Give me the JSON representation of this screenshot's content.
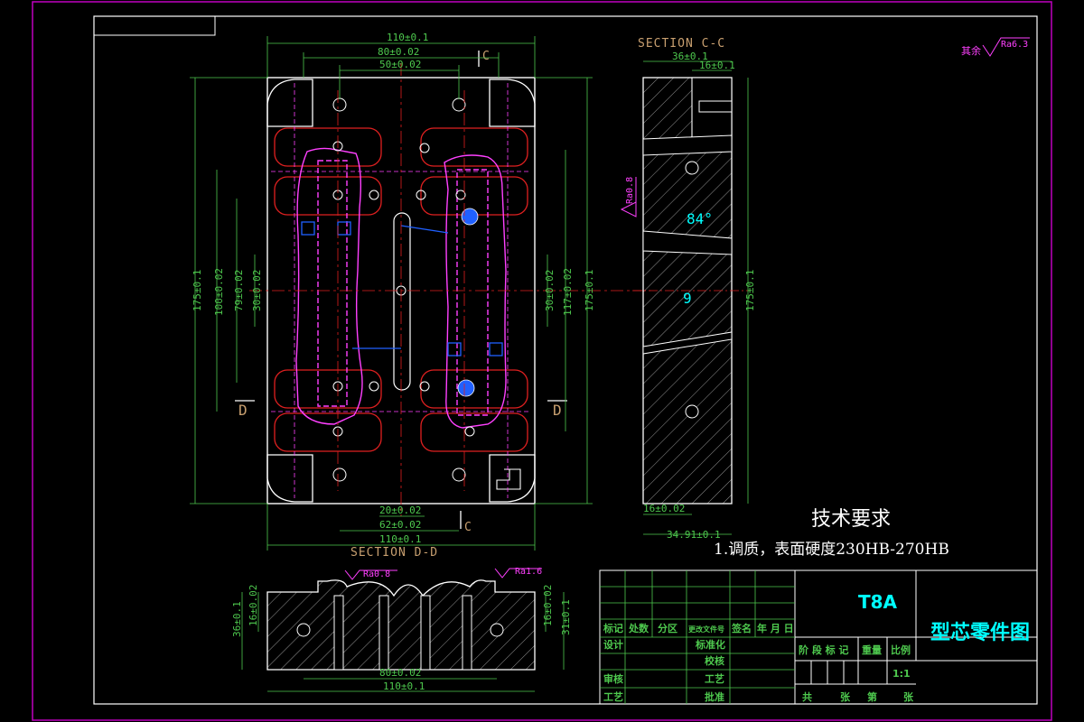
{
  "drawing": {
    "section_cc_title": "SECTION C-C",
    "section_dd_title": "SECTION D-D",
    "section_marker_c": "C",
    "section_marker_d": "D",
    "roughness_note": "其余",
    "roughness_default": "Ra6.3",
    "roughness_08": "Ra0.8",
    "roughness_16": "Ra1.6",
    "tech_title": "技术要求",
    "tech_item_1": "1.调质，表面硬度230HB-270HB"
  },
  "dimensions": {
    "top_110": "110±0.1",
    "top_80": "80±0.02",
    "top_50": "50±0.02",
    "bottom_20": "20±0.02",
    "bottom_62": "62±0.02",
    "bottom_110": "110±0.1",
    "left_175": "175±0.1",
    "left_100": "100±0.02",
    "left_79": "79±0.02",
    "left_30": "30±0.02",
    "right_30": "30±0.02",
    "right_117": "117±0.02",
    "right_175": "175±0.1",
    "cc_36": "36±0.1",
    "cc_16": "16±0.1",
    "cc_175": "175±0.1",
    "cc_bottom_16": "16±0.02",
    "cc_bottom_34": "34.91±0.1",
    "cc_angle": "84°",
    "cc_9": "9",
    "dd_36": "36±0.1",
    "dd_16_left": "16±0.02",
    "dd_16_right": "16±0.02",
    "dd_31": "31±0.1",
    "dd_80": "80±0.02",
    "dd_110": "110±0.1"
  },
  "title_block": {
    "material": "T8A",
    "drawing_name": "型芯零件图",
    "label_mark": "标记",
    "label_count": "处数",
    "label_zone": "分区",
    "label_doc": "更改文件号",
    "label_sign": "签名",
    "label_date": "年 月 日",
    "label_design": "设计",
    "label_standard": "标准化",
    "label_stage": "阶 段 标 记",
    "label_weight": "重量",
    "label_scale": "比例",
    "label_check": "校核",
    "label_review": "审核",
    "label_craft": "工艺",
    "label_proc": "工艺",
    "label_approve": "批准",
    "label_scale_value": "1:1",
    "label_total": "共",
    "label_sheets": "张",
    "label_sheet_no": "第",
    "label_sheet": "张"
  }
}
